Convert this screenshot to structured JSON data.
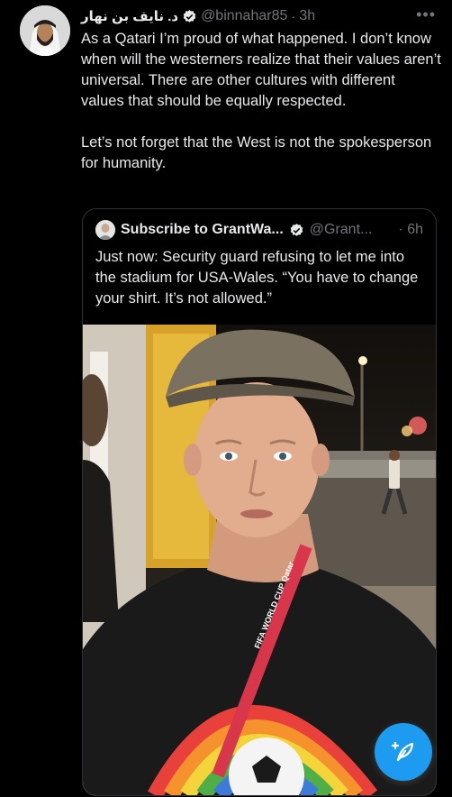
{
  "tweet": {
    "author_name": "د. نايف بن نهار",
    "handle": "@binnahar85",
    "separator": "·",
    "time": "3h",
    "more_label": "•••",
    "paragraphs": [
      "As a Qatari I’m proud of what happened. I don’t know when will the westerners realize that their values aren’t universal. There are other cultures with different values that should be equally respected.",
      "Let’s not forget that the West is not the spokesperson for humanity."
    ]
  },
  "quote": {
    "author_name": "Subscribe to GrantWa...",
    "handle": "@Grant...",
    "separator": "·",
    "time": "6h",
    "text": "Just now: Security guard refusing to let me into the stadium for USA-Wales. “You have to change your shirt. It’s not allowed.”",
    "lanyard_text": "FIFA WORLD CUP Qatar"
  },
  "icons": {
    "verified": "verified-badge-icon",
    "more": "more-options-icon",
    "compose": "compose-tweet-icon"
  },
  "colors": {
    "background": "#000000",
    "text": "#e7e9ea",
    "secondary_text": "#71767b",
    "accent": "#1d9bf0"
  }
}
